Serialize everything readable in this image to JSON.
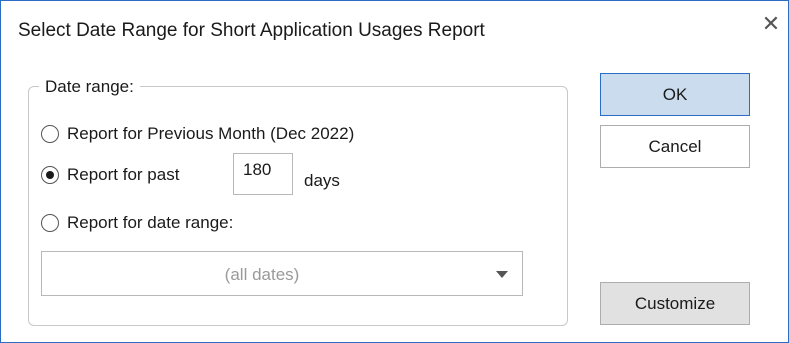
{
  "dialog": {
    "title": "Select Date Range for Short Application Usages Report",
    "close_glyph": "✕"
  },
  "group": {
    "legend": "Date range:",
    "options": [
      {
        "label": "Report for Previous Month (Dec 2022)",
        "selected": false
      },
      {
        "label": "Report for past",
        "selected": true
      },
      {
        "label": "Report for date range:",
        "selected": false
      }
    ],
    "days_value": "180",
    "days_suffix": "days",
    "date_combo_value": "(all dates)"
  },
  "buttons": {
    "ok": "OK",
    "cancel": "Cancel",
    "customize": "Customize"
  },
  "colors": {
    "accent": "#2b6cc4",
    "default_button_bg": "#ccdcef",
    "disabled_text": "#9a9a9a"
  },
  "icons": {
    "close": "close-icon",
    "dropdown": "chevron-down-icon"
  }
}
